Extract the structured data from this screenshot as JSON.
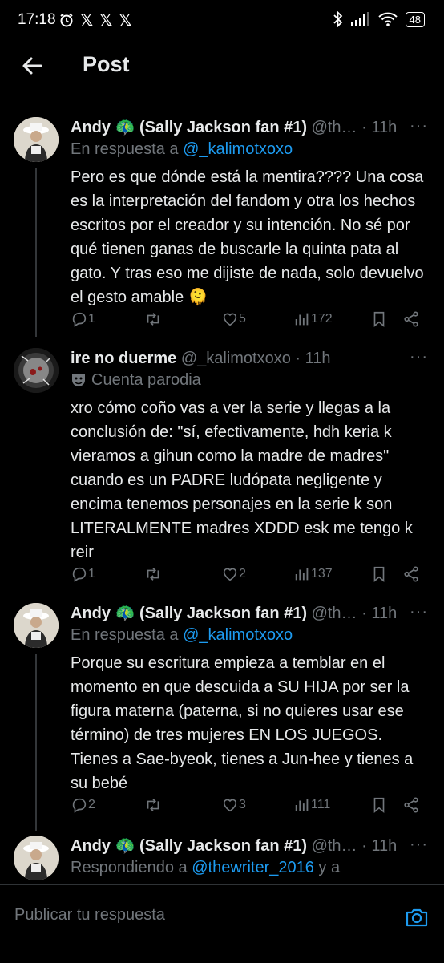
{
  "status_bar": {
    "time": "17:18",
    "battery": "48"
  },
  "header": {
    "title": "Post"
  },
  "tweets": [
    {
      "name": "Andy 🦚 (Sally Jackson fan #1)",
      "handle": "@th…",
      "time": "· 11h",
      "reply_prefix": "En respuesta a",
      "reply_to": "@_kalimotxoxo",
      "text": "Pero es que dónde está la mentira???? Una cosa es la interpretación del fandom y otra los hechos escritos por el creador y su intención. No sé por qué tienen ganas de buscarle la quinta pata al gato. Y tras eso me dijiste de nada, solo devuelvo el gesto amable 🫠",
      "replies": "1",
      "retweets": "",
      "likes": "5",
      "views": "172"
    },
    {
      "name": "ire no duerme",
      "handle": "@_kalimotxoxo",
      "time": "· 11h",
      "parody_label": "Cuenta parodia",
      "text": "xro cómo coño vas a ver la serie y llegas a la conclusión de: \"sí, efectivamente, hdh keria k vieramos a gihun como la madre de madres\" cuando es un PADRE ludópata negligente y encima tenemos personajes en la serie k son LITERALMENTE madres XDDD esk me tengo k reir",
      "replies": "1",
      "retweets": "",
      "likes": "2",
      "views": "137"
    },
    {
      "name": "Andy 🦚 (Sally Jackson fan #1)",
      "handle": "@th…",
      "time": "· 11h",
      "reply_prefix": "En respuesta a",
      "reply_to": "@_kalimotxoxo",
      "text": "Porque su escritura empieza a temblar en el momento en que descuida a SU HIJA por ser la figura materna (paterna, si no quieres usar ese término) de tres mujeres EN LOS JUEGOS. Tienes a Sae-byeok, tienes a Jun-hee y tienes a su bebé",
      "replies": "2",
      "retweets": "",
      "likes": "3",
      "views": "111"
    },
    {
      "name": "Andy 🦚 (Sally Jackson fan #1)",
      "handle": "@th…",
      "time": "· 11h",
      "reply_prefix": "Respondiendo a",
      "reply_to": "@thewriter_2016",
      "reply_suffix": "y a"
    }
  ],
  "composer": {
    "placeholder": "Publicar tu respuesta"
  },
  "colors": {
    "background": "#000000",
    "accent": "#1d9bf0",
    "muted": "#71767b",
    "text": "#e7e9ea"
  },
  "icons": [
    "back-arrow-icon",
    "reply-icon",
    "retweet-icon",
    "like-icon",
    "views-icon",
    "bookmark-icon",
    "share-icon",
    "more-icon",
    "parody-mask-icon",
    "camera-icon"
  ]
}
